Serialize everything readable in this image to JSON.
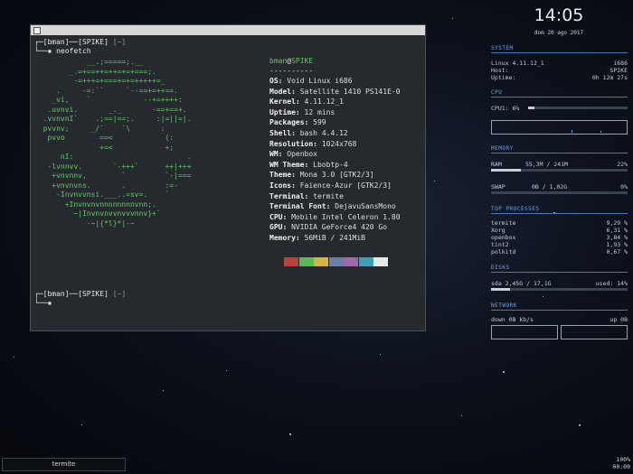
{
  "terminal": {
    "prompt_user": "bman",
    "prompt_host": "SPIKE",
    "prompt_dir": "~",
    "command": "neofetch",
    "logo_lines": [
      "            __.;=====;.__",
      "        _.=+==++=++=+=+===;.",
      "         -=+++=+===+=+=+++++=_",
      "     .     -=:``     `--==+=++==.",
      "    _vi,    `            --+=++++:",
      "   .uvnvi.       _._       -==+==+.",
      "  .vvnvnI`    .;==|==;.     :|=||=|.",
      "  pvvnv;     _/`    `\\       :",
      "   pvvo        ==<            (:",
      "               +=<            +;",
      "      nI:                          .",
      "   -lvnnvv.       `-+++`      ++|+++",
      "    +vnvnnv,        `         `-|===",
      "    +vnvnvns.       .         :=-",
      "     -Invnvvnsi.___..=sv=.    `",
      "       +Invnvnvnnnnnnnnvnn;.",
      "         ~|Invnvnvvnvvvnnv}+`",
      "            -~|{*l}*|-~"
    ],
    "info_header_user": "bman",
    "info_header_at": "@",
    "info_header_host": "SPIKE",
    "info_divider": "----------",
    "info": [
      {
        "key": "OS",
        "value": "Void Linux i686"
      },
      {
        "key": "Model",
        "value": "Satellite 1410 PS141E-0"
      },
      {
        "key": "Kernel",
        "value": "4.11.12_1"
      },
      {
        "key": "Uptime",
        "value": "12 mins"
      },
      {
        "key": "Packages",
        "value": "599"
      },
      {
        "key": "Shell",
        "value": "bash 4.4.12"
      },
      {
        "key": "Resolution",
        "value": "1024x768"
      },
      {
        "key": "WM",
        "value": "Openbox"
      },
      {
        "key": "WM Theme",
        "value": "Lbobtp-4"
      },
      {
        "key": "Theme",
        "value": "Mona 3.0 [GTK2/3]"
      },
      {
        "key": "Icons",
        "value": "Faience-Azur [GTK2/3]"
      },
      {
        "key": "Terminal",
        "value": "termite"
      },
      {
        "key": "Terminal Font",
        "value": "DejavuSansMono"
      },
      {
        "key": "CPU",
        "value": "Mobile Intel Celeron 1.80"
      },
      {
        "key": "GPU",
        "value": "NVIDIA GeForce4 420 Go"
      },
      {
        "key": "Memory",
        "value": "56MiB / 241MiB"
      }
    ],
    "palette": [
      "#b5443b",
      "#5cb85c",
      "#d4b44a",
      "#6a7fa8",
      "#a06aa6",
      "#3ba0b0",
      "#e8e8e8"
    ]
  },
  "conky": {
    "clock": "14:05",
    "date": "dom 20 ago 2017",
    "system_title": "SYSTEM",
    "system_rows": [
      {
        "label": "Linux 4.11.12_1",
        "value": "i686"
      },
      {
        "label": "Host:",
        "value": "SPIKE"
      },
      {
        "label": "Uptime:",
        "value": "0h 12m 27s"
      }
    ],
    "cpu_title": "CPU",
    "cpu_label": "CPU1: 6%",
    "cpu_percent": 6,
    "memory_title": "MEMORY",
    "ram_label": "RAM",
    "ram_value": "55,3M / 241M",
    "ram_pct": "22%",
    "ram_percent": 22,
    "swap_label": "SWAP",
    "swap_value": "0B / 1,02G",
    "swap_pct": "0%",
    "swap_percent": 0,
    "top_title": "TOP PROCESSES",
    "processes": [
      {
        "name": "termite",
        "value": "9,29 %"
      },
      {
        "name": "Xorg",
        "value": "6,31 %"
      },
      {
        "name": "openbox",
        "value": "3,84 %"
      },
      {
        "name": "tint2",
        "value": "1,93 %"
      },
      {
        "name": "polkitd",
        "value": "0,67 %"
      }
    ],
    "disks_title": "DISKS",
    "disk_label": "sda 2,45G / 17,1G",
    "disk_used": "used: 14%",
    "disk_percent": 14,
    "network_title": "NETWORK",
    "down_label": "down 0B kb/s",
    "up_label": "up 0B"
  },
  "taskbar": {
    "task_label": "termite",
    "battery": "100%",
    "time": "00:00"
  }
}
